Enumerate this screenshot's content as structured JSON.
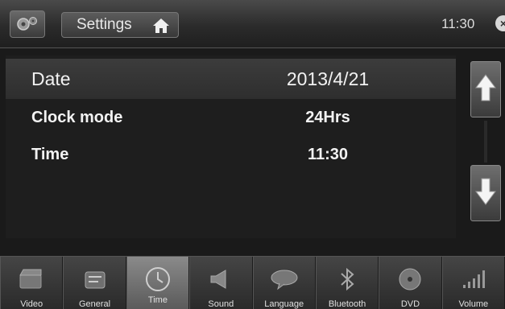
{
  "header": {
    "app_icon": "settings-app-icon",
    "title": "Settings",
    "home_icon": "home-icon",
    "clock": "11:30",
    "close_icon": "close-icon"
  },
  "settings": {
    "rows": [
      {
        "label": "Date",
        "value": "2013/4/21",
        "selected": true
      },
      {
        "label": "Clock mode",
        "value": "24Hrs",
        "selected": false
      },
      {
        "label": "Time",
        "value": "11:30",
        "selected": false
      }
    ]
  },
  "scroll": {
    "up_icon": "arrow-up-icon",
    "down_icon": "arrow-down-icon"
  },
  "tabs": [
    {
      "label": "Video",
      "icon": "video-icon",
      "active": false
    },
    {
      "label": "General",
      "icon": "general-icon",
      "active": false
    },
    {
      "label": "Time",
      "icon": "clock-icon",
      "active": true
    },
    {
      "label": "Sound",
      "icon": "speaker-icon",
      "active": false
    },
    {
      "label": "Language",
      "icon": "language-icon",
      "active": false
    },
    {
      "label": "Bluetooth",
      "icon": "bluetooth-icon",
      "active": false
    },
    {
      "label": "DVD",
      "icon": "disc-icon",
      "active": false
    },
    {
      "label": "Volume",
      "icon": "volume-icon",
      "active": false
    }
  ]
}
